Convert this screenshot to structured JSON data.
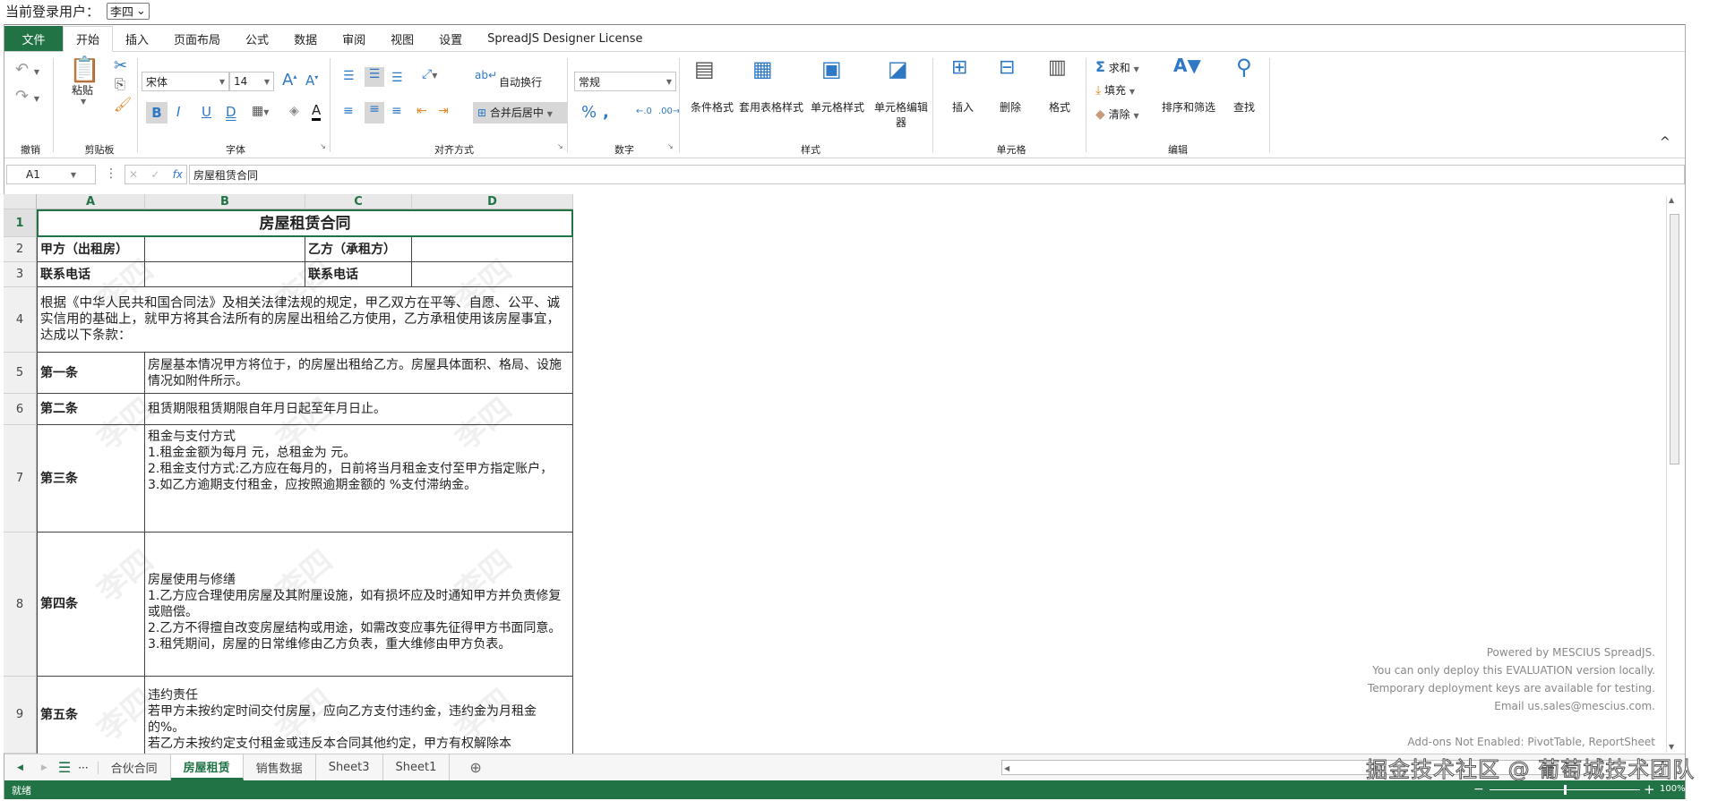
{
  "user": {
    "label": "当前登录用户：",
    "selected": "李四"
  },
  "ribbon": {
    "tabs": [
      "文件",
      "开始",
      "插入",
      "页面布局",
      "公式",
      "数据",
      "审阅",
      "视图",
      "设置",
      "SpreadJS Designer License"
    ],
    "groups": {
      "undo": "撤销",
      "clipboard": "剪贴板",
      "font": "字体",
      "align": "对齐方式",
      "number": "数字",
      "style": "样式",
      "cells": "单元格",
      "edit": "编辑"
    },
    "paste": "粘贴",
    "font_name": "宋体",
    "font_size": "14",
    "wrap": "自动换行",
    "merge": "合并后居中",
    "number_format": "常规",
    "style_buttons": [
      "条件格式",
      "套用表格样式",
      "单元格样式",
      "单元格编辑器"
    ],
    "cell_buttons": [
      "插入",
      "删除",
      "格式"
    ],
    "edit_buttons": {
      "sum": "求和",
      "fill": "填充",
      "clear": "清除",
      "sort": "排序和筛选",
      "find": "查找"
    },
    "accent": "#217346"
  },
  "formula": {
    "cell_ref": "A1",
    "fx": "fx",
    "value": "房屋租赁合同"
  },
  "sheet": {
    "columns": [
      "A",
      "B",
      "C",
      "D"
    ],
    "rows": [
      "1",
      "2",
      "3",
      "4",
      "5",
      "6",
      "7",
      "8",
      "9"
    ],
    "title": "房屋租赁合同",
    "r2": [
      "甲方（出租房）",
      "乙方（承租方）"
    ],
    "r3": [
      "联系电话",
      "联系电话"
    ],
    "r4": "根据《中华人民共和国合同法》及相关法律法规的规定，甲乙双方在平等、自愿、公平、诚实信用的基础上，就甲方将其合法所有的房屋出租给乙方使用，乙方承租使用该房屋事宜，达成以下条款：",
    "articles": [
      {
        "name": "第一条",
        "text": "房屋基本情况甲方将位于，的房屋出租给乙方。房屋具体面积、格局、设施情况如附件所示。"
      },
      {
        "name": "第二条",
        "text": "租赁期限租赁期限自年月日起至年月日止。"
      },
      {
        "name": "第三条",
        "text": "租金与支付方式\n1.租金金额为每月 元，总租金为 元。\n2.租金支付方式:乙方应在每月的，日前将当月租金支付至甲方指定账户，\n3.如乙方逾期支付租金，应按照逾期金额的 %支付滞纳金。"
      },
      {
        "name": "第四条",
        "text": "房屋使用与修缮\n1.乙方应合理使用房屋及其附厘设施，如有损坏应及时通知甲方并负责修复或赔偿。\n2.乙方不得擅自改变房屋结构或用途，如需改变应事先征得甲方书面同意。\n3.租凭期间，房屋的日常维修由乙方负表，重大维修由甲方负表。"
      },
      {
        "name": "第五条",
        "text": "违约责任\n若甲方未按约定时间交付房屋，应向乙方支付违约金，违约金为月租金的%。\n若乙方未按约定支付租金或违反本合同其他约定，甲方有权解除本"
      }
    ],
    "watermark": "李四"
  },
  "eval": [
    "Powered by MESCIUS SpreadJS.",
    "You can only deploy this EVALUATION version locally.",
    "Temporary deployment keys are available for testing.",
    "Email us.sales@mescius.com.",
    "Add-ons Not Enabled: PivotTable, ReportSheet"
  ],
  "sheet_tabs": [
    "合伙合同",
    "房屋租赁",
    "销售数据",
    "Sheet3",
    "Sheet1"
  ],
  "status": {
    "text": "就绪",
    "zoom": "100%",
    "zoom_value": 100
  },
  "credit": "掘金技术社区 @ 葡萄城技术团队"
}
